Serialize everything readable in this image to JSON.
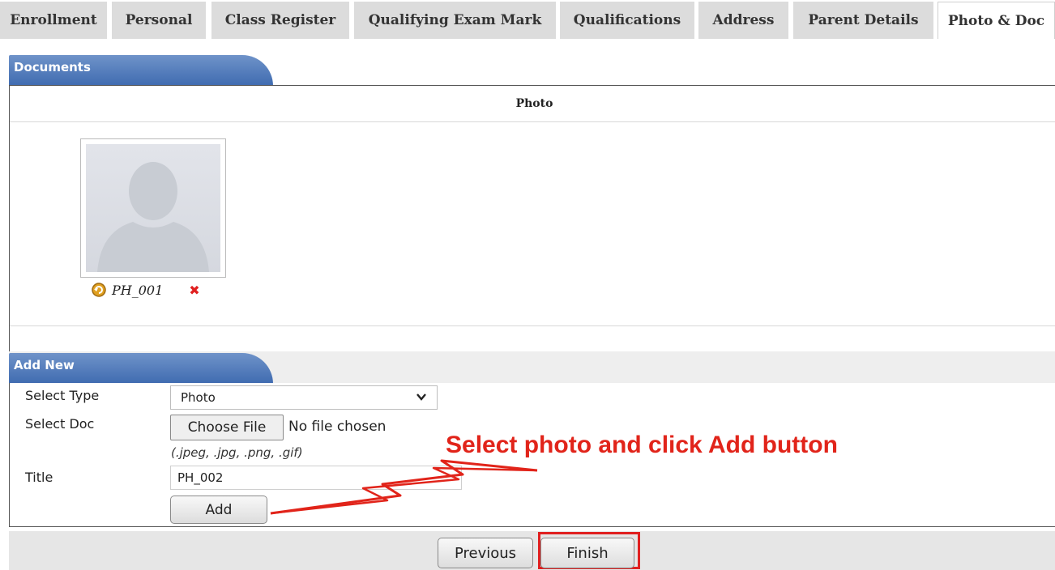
{
  "tabs": [
    {
      "label": "Enrollment"
    },
    {
      "label": "Personal"
    },
    {
      "label": "Class Register"
    },
    {
      "label": "Qualifying Exam Mark"
    },
    {
      "label": "Qualifications"
    },
    {
      "label": "Address"
    },
    {
      "label": "Parent Details"
    },
    {
      "label": "Photo & Doc",
      "active": true
    }
  ],
  "documents": {
    "section_title": "Documents",
    "column_header": "Photo",
    "photo": {
      "name": "PH_001",
      "delete_glyph": "✖",
      "icons": [
        "person-placeholder-icon",
        "replace-icon",
        "delete-icon"
      ]
    }
  },
  "add_new": {
    "section_title": "Add New",
    "type_label": "Select Type",
    "type_value": "Photo",
    "doc_label": "Select Doc",
    "file_button": "Choose File",
    "file_status": "No file chosen",
    "allowed_types": "(.jpeg, .jpg, .png, .gif)",
    "title_label": "Title",
    "title_value": "PH_002",
    "add_button": "Add"
  },
  "annotation": {
    "text": "Select photo and click Add button",
    "color": "#e1241a"
  },
  "footer": {
    "previous_button": "Previous",
    "finish_button": "Finish"
  },
  "colors": {
    "section_header": "#4a74b6",
    "tab_bg": "#dcdcdc",
    "highlight": "#e02020"
  }
}
